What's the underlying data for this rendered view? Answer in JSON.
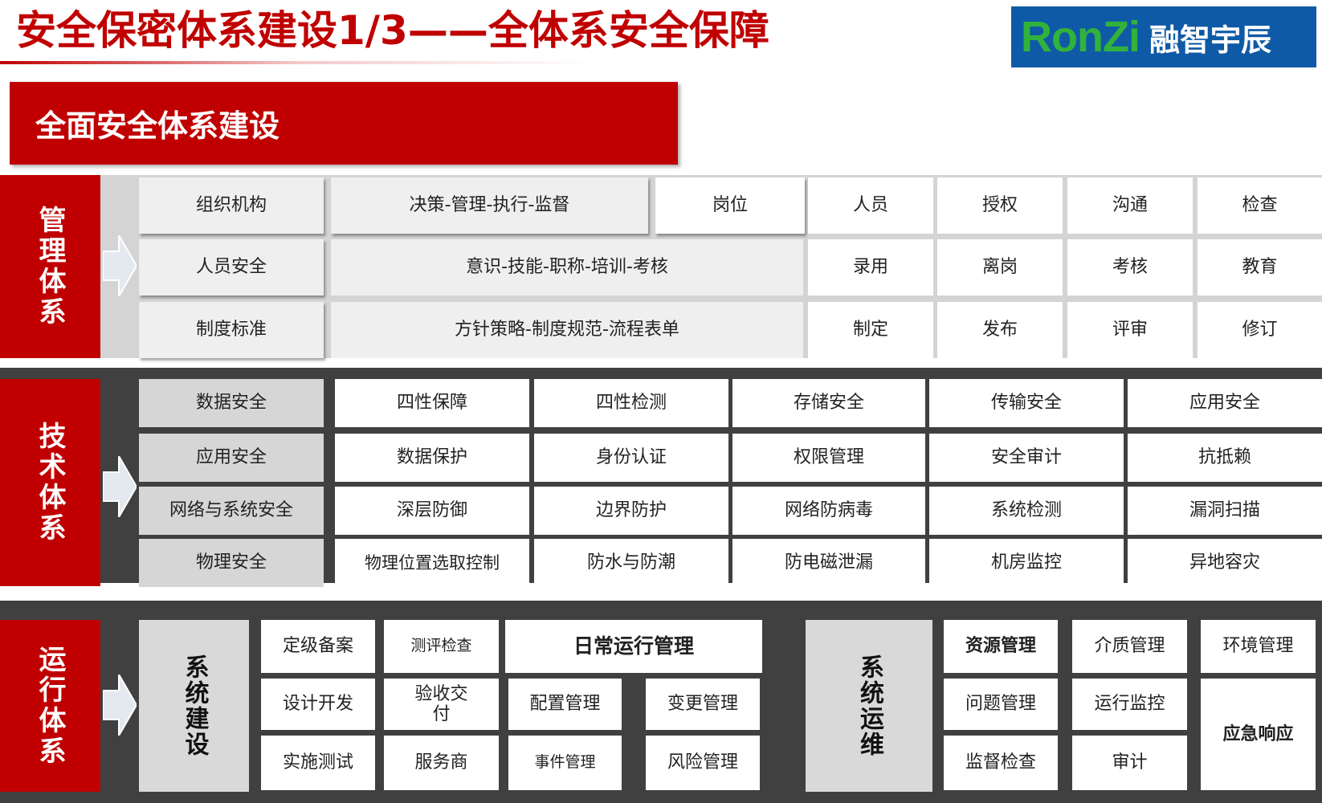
{
  "title": "安全保密体系建设1/3——全体系安全保障",
  "logo": {
    "brand": "RonZi",
    "name": "融智宇辰"
  },
  "banner": "全面安全体系建设",
  "management": {
    "label": "管理体系",
    "row1": [
      "组织机构",
      "决策-管理-执行-监督",
      "岗位",
      "人员",
      "授权",
      "沟通",
      "检查"
    ],
    "row2": [
      "人员安全",
      "意识-技能-职称-培训-考核",
      "录用",
      "离岗",
      "考核",
      "教育"
    ],
    "row3": [
      "制度标准",
      "方针策略-制度规范-流程表单",
      "制定",
      "发布",
      "评审",
      "修订"
    ]
  },
  "technical": {
    "label": "技术体系",
    "rows": [
      [
        "数据安全",
        "四性保障",
        "四性检测",
        "存储安全",
        "传输安全",
        "应用安全"
      ],
      [
        "应用安全",
        "数据保护",
        "身份认证",
        "权限管理",
        "安全审计",
        "抗抵赖"
      ],
      [
        "网络与系统安全",
        "深层防御",
        "边界防护",
        "网络防病毒",
        "系统检测",
        "漏洞扫描"
      ],
      [
        "物理安全",
        "物理位置选取控制",
        "防水与防潮",
        "防电磁泄漏",
        "机房监控",
        "异地容灾"
      ]
    ]
  },
  "operation": {
    "label": "运行体系",
    "construction": {
      "label": "系统建设",
      "items": [
        "定级备案",
        "测评检查",
        "设计开发",
        "验收交付",
        "实施测试",
        "服务商"
      ]
    },
    "daily": {
      "header": "日常运行管理",
      "items": [
        "配置管理",
        "变更管理",
        "事件管理",
        "风险管理"
      ]
    },
    "maintenance": {
      "label": "系统运维",
      "items": [
        "资源管理",
        "介质管理",
        "环境管理",
        "问题管理",
        "运行监控",
        "监督检查",
        "审计",
        "应急响应"
      ]
    }
  }
}
